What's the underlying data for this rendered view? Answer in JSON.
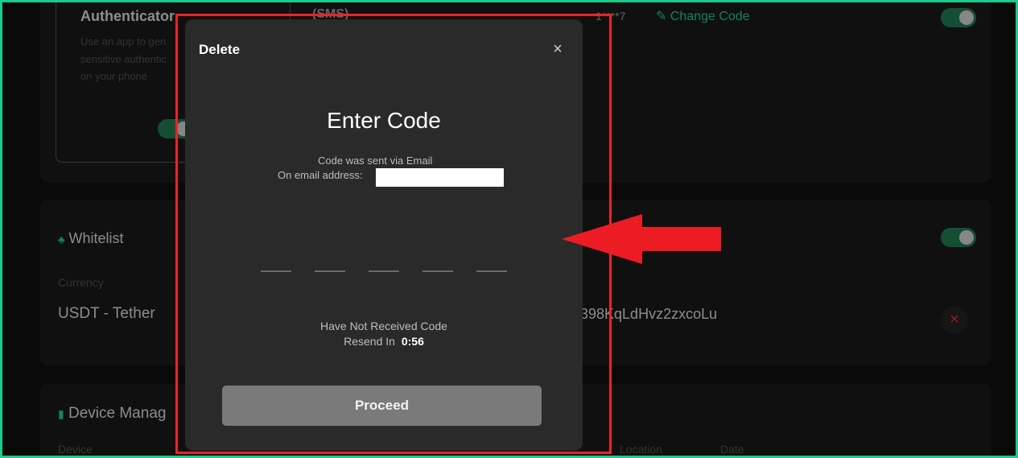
{
  "background": {
    "authenticator_title": "Authenticator",
    "authenticator_desc_1": "Use an app to gen",
    "authenticator_desc_2": "sensitive authentic",
    "authenticator_desc_3": "on your phone",
    "sms_label": "(SMS)",
    "phone_masked": "1****7",
    "change_code_label": "Change Code",
    "whitelist_title": "Whitelist",
    "currency_header": "Currency",
    "currency_value": "USDT - Tether",
    "address_fragment": "398KqLdHvz2zxcoLu",
    "device_title": "Device Manag",
    "device_header": "Device",
    "location_header": "Location",
    "date_header": "Date"
  },
  "modal": {
    "title": "Delete",
    "close_label": "×",
    "heading": "Enter Code",
    "sent_via": "Code was sent via Email",
    "email_label": "On email address:",
    "not_received": "Have Not Received Code",
    "resend_label": "Resend In",
    "resend_timer": "0:56",
    "proceed_label": "Proceed"
  },
  "colors": {
    "accent": "#1ec98c",
    "annotation": "#e8242b",
    "toggle_on": "#1f7a52"
  }
}
